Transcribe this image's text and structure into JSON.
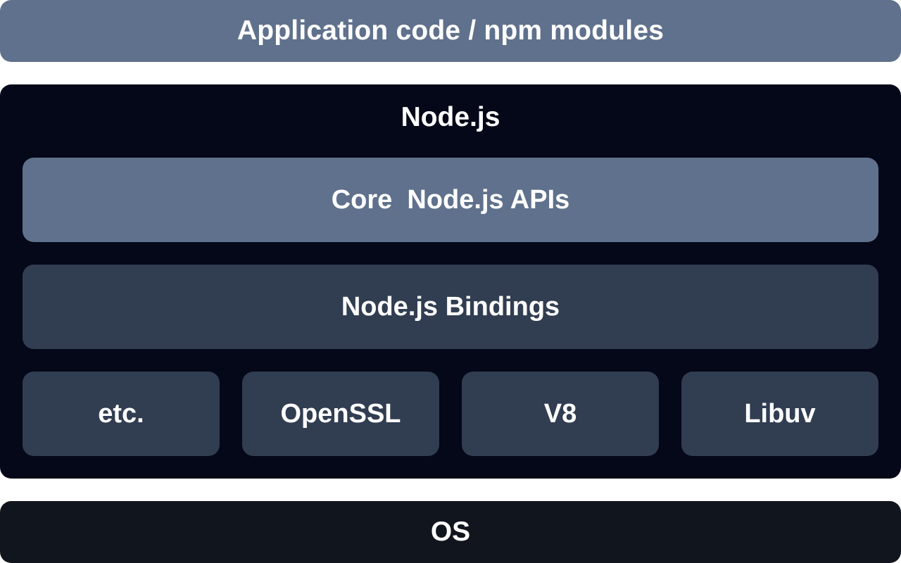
{
  "layers": {
    "application": "Application code / npm modules",
    "nodejs": {
      "title": "Node.js",
      "core_apis": "Core  Node.js APIs",
      "bindings": "Node.js Bindings",
      "dependencies": [
        "etc.",
        "OpenSSL",
        "V8",
        "Libuv"
      ]
    },
    "os": "OS"
  },
  "colors": {
    "slate_blue": "#5f718c",
    "dark_slate": "#313d51",
    "node_background": "#040818",
    "os_background": "#11151d",
    "text": "#ffffff"
  }
}
